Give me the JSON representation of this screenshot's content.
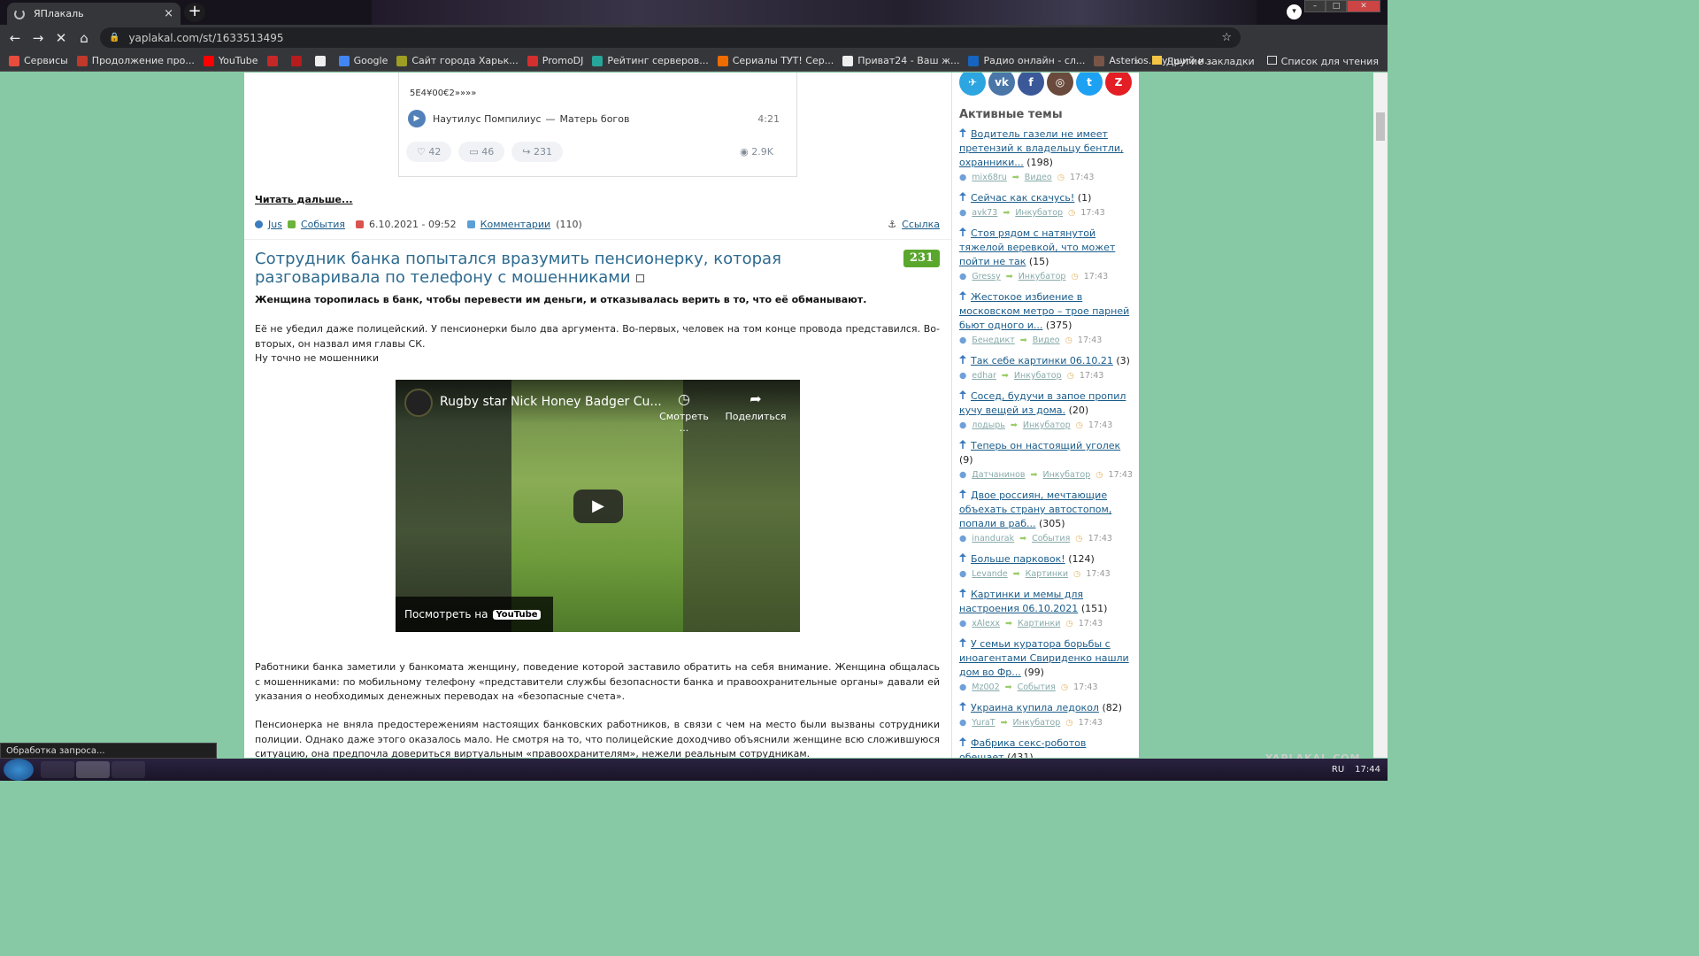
{
  "browser": {
    "tab_title": "ЯПлакаль",
    "tab_close": "×",
    "new_tab": "+",
    "url": "yaplakal.com/st/1633513495",
    "nav": {
      "back": "←",
      "forward": "→",
      "reload": "✕",
      "home": "⌂"
    },
    "bookmarks": [
      {
        "label": "Сервисы",
        "color": "#e74c3c"
      },
      {
        "label": "Продолжение про...",
        "color": "#c0392b"
      },
      {
        "label": "YouTube",
        "color": "#ff0000"
      },
      {
        "label": "",
        "color": "#c62828"
      },
      {
        "label": "",
        "color": "#b71c1c"
      },
      {
        "label": "",
        "color": "#eeeeee"
      },
      {
        "label": "Google",
        "color": "#4285f4"
      },
      {
        "label": "Сайт города Харьк...",
        "color": "#9e9d24"
      },
      {
        "label": "PromoDJ",
        "color": "#d32f2f"
      },
      {
        "label": "Рейтинг серверов...",
        "color": "#26a69a"
      },
      {
        "label": "Сериалы ТУТ! Сер...",
        "color": "#ef6c00"
      },
      {
        "label": "Приват24 - Ваш ж...",
        "color": "#eeeeee"
      },
      {
        "label": "Радио онлайн - сл...",
        "color": "#1565c0"
      },
      {
        "label": "Asterios. Лучший и...",
        "color": "#795548"
      }
    ],
    "bookmarks_more": "»",
    "other_bookmarks": "Другие закладки",
    "reading_list": "Список для чтения",
    "status_text": "Обработка запроса..."
  },
  "vk_post": {
    "text": "5E4¥00€2»»»»",
    "track_artist": "Наутилус Помпилиус",
    "track_dash": "—",
    "track_title": "Матерь богов",
    "track_duration": "4:21",
    "likes": "42",
    "comments": "46",
    "shares": "231",
    "views": "2.9K"
  },
  "read_more": "Читать дальше...",
  "prev_meta": {
    "author": "Jus",
    "category": "События",
    "date": "6.10.2021 - 09:52",
    "comments_label": "Комментарии",
    "comments_count": "(110)",
    "link_label": "Ссылка"
  },
  "post": {
    "title": "Сотрудник банка попытался вразумить пенсионерку, которая разговаривала по телефону с мошенниками",
    "rating": "231",
    "lead": "Женщина торопилась в банк, чтобы перевести им деньги, и отказывалась верить в то, что её обманывают.",
    "p1": "Её не убедил даже полицейский. У пенсионерки было два аргумента. Во-первых, человек на том конце провода представился. Во-вторых, он назвал имя главы СК.",
    "p1b": "Ну точно не мошенники",
    "video": {
      "title": "Rugby star Nick Honey Badger Cu...",
      "watch_later": "Смотреть ...",
      "share": "Поделиться",
      "watch_on": "Посмотреть на",
      "yt_logo": "YouTube"
    },
    "p2": "Работники банка заметили у банкомата женщину, поведение которой заставило обратить на себя внимание. Женщина общалась с мошенниками: по мобильному телефону «представители службы безопасности банка и правоохранительные органы» давали ей указания о необходимых денежных переводах на «безопасные счета».",
    "p3": "Пенсионерка не вняла предостережениям настоящих банковских работников, в связи с чем на место были вызваны сотрудники полиции. Однако даже этого оказалось мало. Не смотря на то, что полицейские доходчиво объяснили женщине всю сложившуюся ситуацию, она предпочла довериться виртуальным «правоохранителям», нежели реальным сотрудникам."
  },
  "sidebar": {
    "heading": "Активные темы",
    "social": [
      {
        "name": "telegram",
        "glyph": "✈",
        "color": "#2ca5e0"
      },
      {
        "name": "vk",
        "glyph": "vk",
        "color": "#4a76a8"
      },
      {
        "name": "facebook",
        "glyph": "f",
        "color": "#3b5998"
      },
      {
        "name": "instagram",
        "glyph": "◎",
        "color": "#6a4a3c"
      },
      {
        "name": "twitter",
        "glyph": "t",
        "color": "#1da1f2"
      },
      {
        "name": "zen",
        "glyph": "Z",
        "color": "#e31e24"
      }
    ],
    "topics": [
      {
        "title": "Водитель газели не имеет претензий к владельцу бентли, охранники...",
        "count": "(198)",
        "author": "mix68ru",
        "category": "Видео",
        "time": "17:43"
      },
      {
        "title": "Сейчас как скачусь!",
        "count": "(1)",
        "author": "avk73",
        "category": "Инкубатор",
        "time": "17:43"
      },
      {
        "title": "Стоя рядом с натянутой тяжелой веревкой, что может пойти не так",
        "count": "(15)",
        "author": "Gressy",
        "category": "Инкубатор",
        "time": "17:43"
      },
      {
        "title": "Жестокое избиение в московском метро – трое парней бьют одного и...",
        "count": "(375)",
        "author": "Бенедикт",
        "category": "Видео",
        "time": "17:43"
      },
      {
        "title": "Так себе картинки 06.10.21",
        "count": "(3)",
        "author": "edhar",
        "category": "Инкубатор",
        "time": "17:43"
      },
      {
        "title": "Сосед, будучи в запое пропил кучу вещей из дома.",
        "count": "(20)",
        "author": "лодырь",
        "category": "Инкубатор",
        "time": "17:43"
      },
      {
        "title": "Теперь он настоящий уголек",
        "count": "(9)",
        "author": "Датчанинов",
        "category": "Инкубатор",
        "time": "17:43"
      },
      {
        "title": "Двое россиян, мечтающие объехать страну автостопом, попали в раб...",
        "count": "(305)",
        "author": "inandurak",
        "category": "События",
        "time": "17:43"
      },
      {
        "title": "Больше парковок!",
        "count": "(124)",
        "author": "Levande",
        "category": "Картинки",
        "time": "17:43"
      },
      {
        "title": "Картинки и мемы для настроения 06.10.2021",
        "count": "(151)",
        "author": "xAlexx",
        "category": "Картинки",
        "time": "17:43"
      },
      {
        "title": "У семьи куратора борьбы с иноагентами Свириденко нашли дом во Фр...",
        "count": "(99)",
        "author": "Mz002",
        "category": "События",
        "time": "17:43"
      },
      {
        "title": "Украина купила ледокол",
        "count": "(82)",
        "author": "YuraT",
        "category": "Инкубатор",
        "time": "17:43"
      },
      {
        "title": "Фабрика секс-роботов обещает",
        "count": "(431)",
        "author": "",
        "category": "",
        "time": ""
      }
    ]
  },
  "watermark": "YAPLAKAL.COM",
  "taskbar": {
    "lang": "RU",
    "clock": "17:44"
  }
}
